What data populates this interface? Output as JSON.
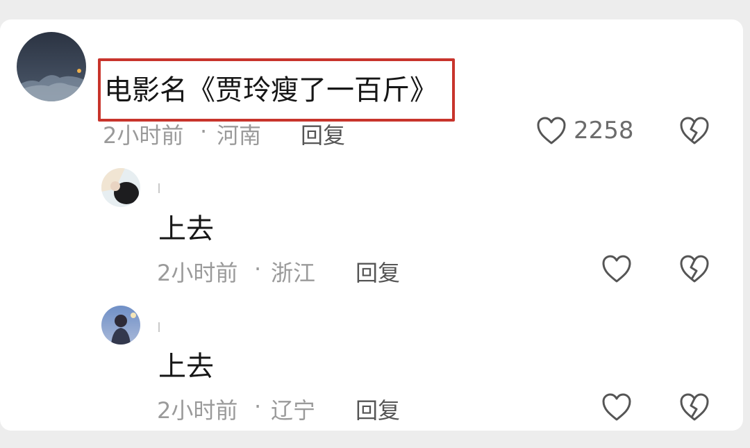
{
  "comments": [
    {
      "text": "电影名《贾玲瘦了一百斤》",
      "time": "2小时前",
      "separator": "·",
      "location": "河南",
      "reply_label": "回复",
      "likes": "2258"
    },
    {
      "text": "上去",
      "time": "2小时前",
      "separator": "·",
      "location": "浙江",
      "reply_label": "回复"
    },
    {
      "text": "上去",
      "time": "2小时前",
      "separator": "·",
      "location": "辽宁",
      "reply_label": "回复"
    }
  ],
  "colors": {
    "highlight_border": "#c8342c",
    "meta_text": "#9a9a9a",
    "icon_stroke": "#555555"
  },
  "icons": {
    "like": "heart-outline-icon",
    "dislike": "broken-heart-icon"
  }
}
